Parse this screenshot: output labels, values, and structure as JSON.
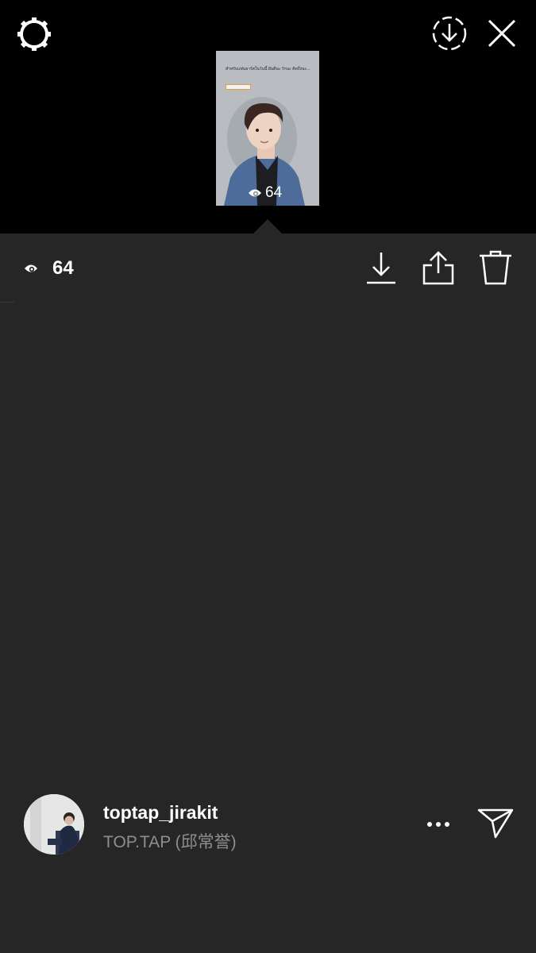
{
  "header": {
    "views_overlay": "64"
  },
  "story": {
    "caption": "สำหรับแฟนอาร์ตในวันนี้ ฝันดีนะ รักนะ คิดถึงนะ..."
  },
  "stats": {
    "views_count": "64"
  },
  "viewer": {
    "username": "toptap_jirakit",
    "full_name": "TOP.TAP (邱常誉)"
  },
  "icons": {
    "settings": "gear-icon",
    "save_story": "dashed-download-circle-icon",
    "close": "close-icon",
    "eye": "eye-icon",
    "download": "download-icon",
    "share": "share-icon",
    "delete": "trash-icon",
    "more": "more-dots-icon",
    "send": "paper-plane-icon"
  }
}
